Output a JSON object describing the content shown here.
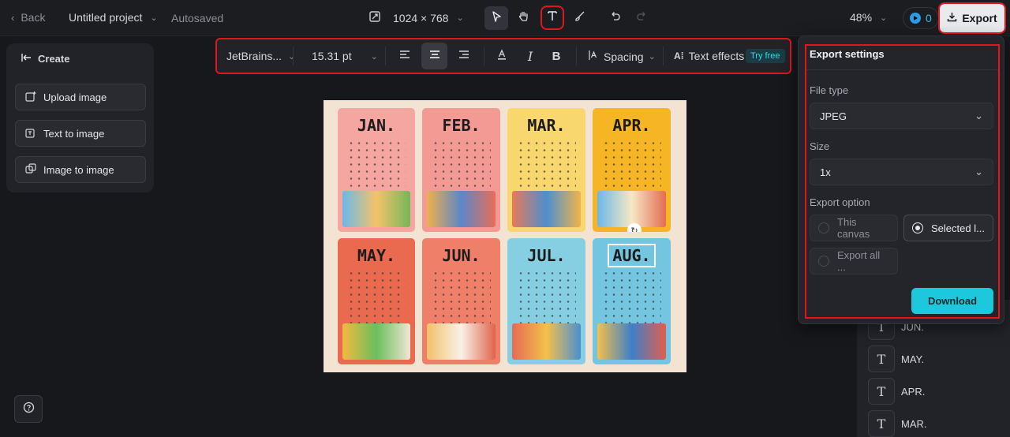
{
  "topbar": {
    "back_label": "Back",
    "project_title": "Untitled project",
    "save_status": "Autosaved",
    "canvas_size": "1024 × 768",
    "zoom": "48%",
    "credits": "0",
    "export_label": "Export"
  },
  "text_toolbar": {
    "font": "JetBrains...",
    "font_size": "15.31 pt",
    "spacing_label": "Spacing",
    "text_effects_label": "Text effects",
    "try_free_badge": "Try free"
  },
  "create_panel": {
    "title": "Create",
    "items": [
      "Upload image",
      "Text to image",
      "Image to image"
    ]
  },
  "canvas": {
    "months": [
      "JAN.",
      "FEB.",
      "MAR.",
      "APR.",
      "MAY.",
      "JUN.",
      "JUL.",
      "AUG."
    ]
  },
  "export_panel": {
    "title": "Export settings",
    "file_type_label": "File type",
    "file_type_value": "JPEG",
    "size_label": "Size",
    "size_value": "1x",
    "export_option_label": "Export option",
    "options": [
      "This canvas",
      "Selected l...",
      "Export all ..."
    ],
    "selected_option": "Selected l...",
    "download_label": "Download"
  },
  "layers": [
    "JUN.",
    "MAY.",
    "APR.",
    "MAR."
  ],
  "colors": {
    "accent": "#1ec8dc",
    "highlight": "#e1161f",
    "background": "#17181c"
  }
}
